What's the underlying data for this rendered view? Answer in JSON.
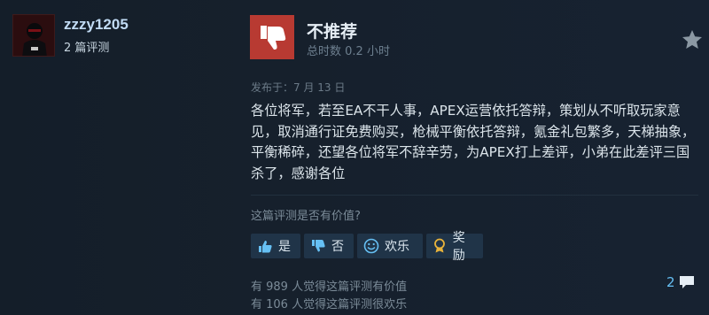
{
  "author": {
    "name": "zzzy1205",
    "review_count": "2 篇评测"
  },
  "review": {
    "verdict": "不推荐",
    "hours": "总时数 0.2 小时",
    "posted": "发布于：7 月 13 日",
    "body": "各位将军，若至EA不干人事，APEX运营依托答辩，策划从不听取玩家意见，取消通行证免费购买，枪械平衡依托答辩，氪金礼包繁多，天梯抽象，平衡稀碎，还望各位将军不辞辛劳，为APEX打上差评，小弟在此差评三国杀了，感谢各位"
  },
  "helpful": {
    "question": "这篇评测是否有价值?",
    "yes_label": "是",
    "no_label": "否",
    "funny_label": "欢乐",
    "award_label": "奖励",
    "stat_helpful": "有 989 人觉得这篇评测有价值",
    "stat_funny": "有 106 人觉得这篇评测很欢乐",
    "comment_count": "2"
  },
  "colors": {
    "thumb_down_bg": "#b83a32",
    "link_blue": "#66c0f4",
    "author_name": "#c1dbf4"
  },
  "icons": [
    "avatar-ninja",
    "thumbs-down-icon",
    "star-award-icon",
    "thumbs-up-icon",
    "smiley-icon",
    "award-ribbon-icon",
    "comment-bubble-icon"
  ]
}
